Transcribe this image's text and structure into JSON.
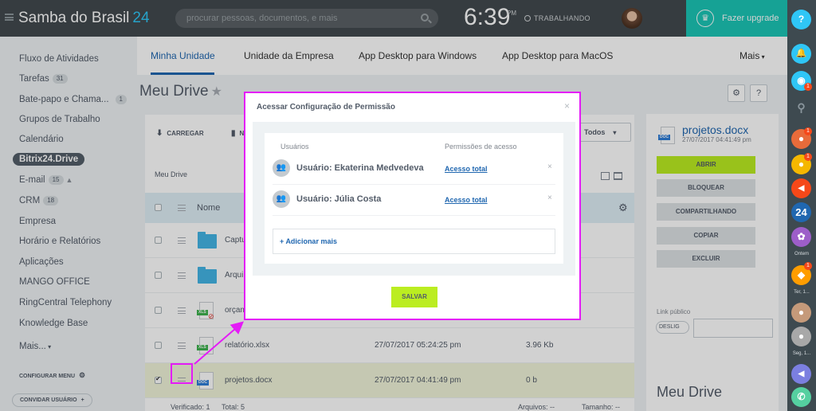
{
  "header": {
    "brand": "Samba do Brasil",
    "brand_num": "24",
    "search_placeholder": "procurar pessoas, documentos, e mais",
    "time": "6:39",
    "ampm": "PM",
    "status": "TRABALHANDO",
    "upgrade": "Fazer upgrade",
    "upgrade_icon": "crown-icon"
  },
  "rightbar": {
    "help": "?",
    "badges": [
      "1",
      "1",
      "1",
      "1"
    ],
    "num24": "24",
    "label_ontem": "Ontem",
    "label_ter": "Ter, 1...",
    "label_seg": "Seg, 1..."
  },
  "sidebar": {
    "items": [
      {
        "label": "Fluxo de Atividades"
      },
      {
        "label": "Tarefas",
        "count": "31"
      },
      {
        "label": "Bate-papo e Chama...",
        "count": "1"
      },
      {
        "label": "Grupos de Trabalho"
      },
      {
        "label": "Calendário"
      },
      {
        "label": "Bitrix24.Drive"
      },
      {
        "label": "E-mail",
        "count": "15"
      },
      {
        "label": "CRM",
        "count": "18"
      },
      {
        "label": "Empresa"
      },
      {
        "label": "Horário e Relatórios"
      },
      {
        "label": "Aplicações"
      },
      {
        "label": "MANGO OFFICE"
      },
      {
        "label": "RingCentral Telephony"
      },
      {
        "label": "Knowledge Base"
      },
      {
        "label": "Mais..."
      }
    ],
    "configure": "CONFIGURAR MENU",
    "invite": "CONVIDAR USUÁRIO"
  },
  "tabs": [
    "Minha Unidade",
    "Unidade da Empresa",
    "App Desktop para Windows",
    "App Desktop para MacOS",
    "Mais"
  ],
  "page_title": "Meu Drive",
  "toolbar": {
    "upload": "CARREGAR",
    "new": "N",
    "filter": "Todos",
    "crumb": "Meu Drive"
  },
  "table": {
    "col_name": "Nome",
    "rows": [
      {
        "name": "Captu",
        "type": "folder",
        "date": "",
        "size": ""
      },
      {
        "name": "Arqui",
        "type": "folder",
        "date": "",
        "size": ""
      },
      {
        "name": "orçam",
        "type": "xls",
        "tag": "XLS",
        "date": "",
        "size": ""
      },
      {
        "name": "relatório.xlsx",
        "type": "xls",
        "tag": "XLS",
        "date": "27/07/2017 05:24:25 pm",
        "size": "3.96 Kb"
      },
      {
        "name": "projetos.docx",
        "type": "doc",
        "tag": "DOC",
        "date": "27/07/2017 04:41:49 pm",
        "size": "0 b"
      }
    ],
    "footer": {
      "verified": "Verificado: 1",
      "total": "Total: 5",
      "files": "Arquivos: --",
      "size": "Tamanho: --"
    }
  },
  "detail": {
    "filename": "projetos.docx",
    "date": "27/07/2017 04:41:49 pm",
    "tag": "DOC",
    "buttons": [
      "ABRIR",
      "BLOQUEAR",
      "COMPARTILHANDO",
      "COPIAR",
      "EXCLUIR"
    ],
    "public_link": "Link público",
    "toggle": "DESLIG",
    "drive_title": "Meu Drive"
  },
  "modal": {
    "title": "Acessar Configuração de Permissão",
    "col_users": "Usuários",
    "col_perms": "Permissões de acesso",
    "users": [
      {
        "name": "Usuário: Ekaterina Medvedeva",
        "perm": "Acesso total"
      },
      {
        "name": "Usuário: Júlia Costa",
        "perm": "Acesso total"
      }
    ],
    "add_more": "Adicionar mais",
    "save": "SALVAR",
    "highlight_color": "#e41bf6"
  }
}
